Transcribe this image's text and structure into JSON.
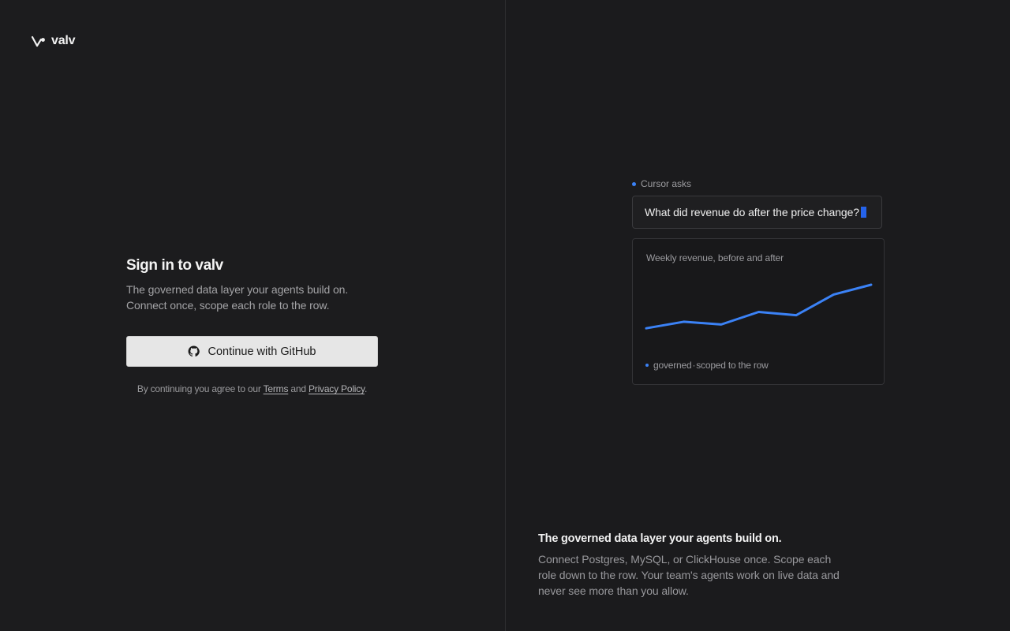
{
  "brand": {
    "name": "valv"
  },
  "signin": {
    "title": "Sign in to valv",
    "subtitle_line1": "The governed data layer your agents build on.",
    "subtitle_line2": "Connect once, scope each role to the row.",
    "github_button": "Continue with GitHub",
    "legal_prefix": "By continuing you agree to our",
    "terms_link": "Terms",
    "legal_and": "and",
    "privacy_link": "Privacy Policy",
    "legal_suffix": "."
  },
  "demo": {
    "asker": "Cursor asks",
    "question": "What did revenue do after the price change?",
    "chart_title": "Weekly revenue, before and after",
    "footer_a": "governed",
    "footer_sep": "·",
    "footer_b": "scoped to the row"
  },
  "tagline": {
    "title": "The governed data layer your agents build on.",
    "body": "Connect Postgres, MySQL, or ClickHouse once. Scope each role down to the row. Your team's agents work on live data and never see more than you allow."
  },
  "colors": {
    "accent": "#3b82f6",
    "caret": "#2563eb",
    "background": "#1c1c1e"
  },
  "chart_data": {
    "type": "line",
    "title": "Weekly revenue, before and after",
    "x": [
      1,
      2,
      3,
      4,
      5,
      6,
      7
    ],
    "series": [
      {
        "values": [
          20,
          32,
          27,
          50,
          44,
          82,
          100
        ]
      }
    ],
    "ylim": [
      0,
      100
    ],
    "grid": false,
    "color": "#3b82f6"
  }
}
